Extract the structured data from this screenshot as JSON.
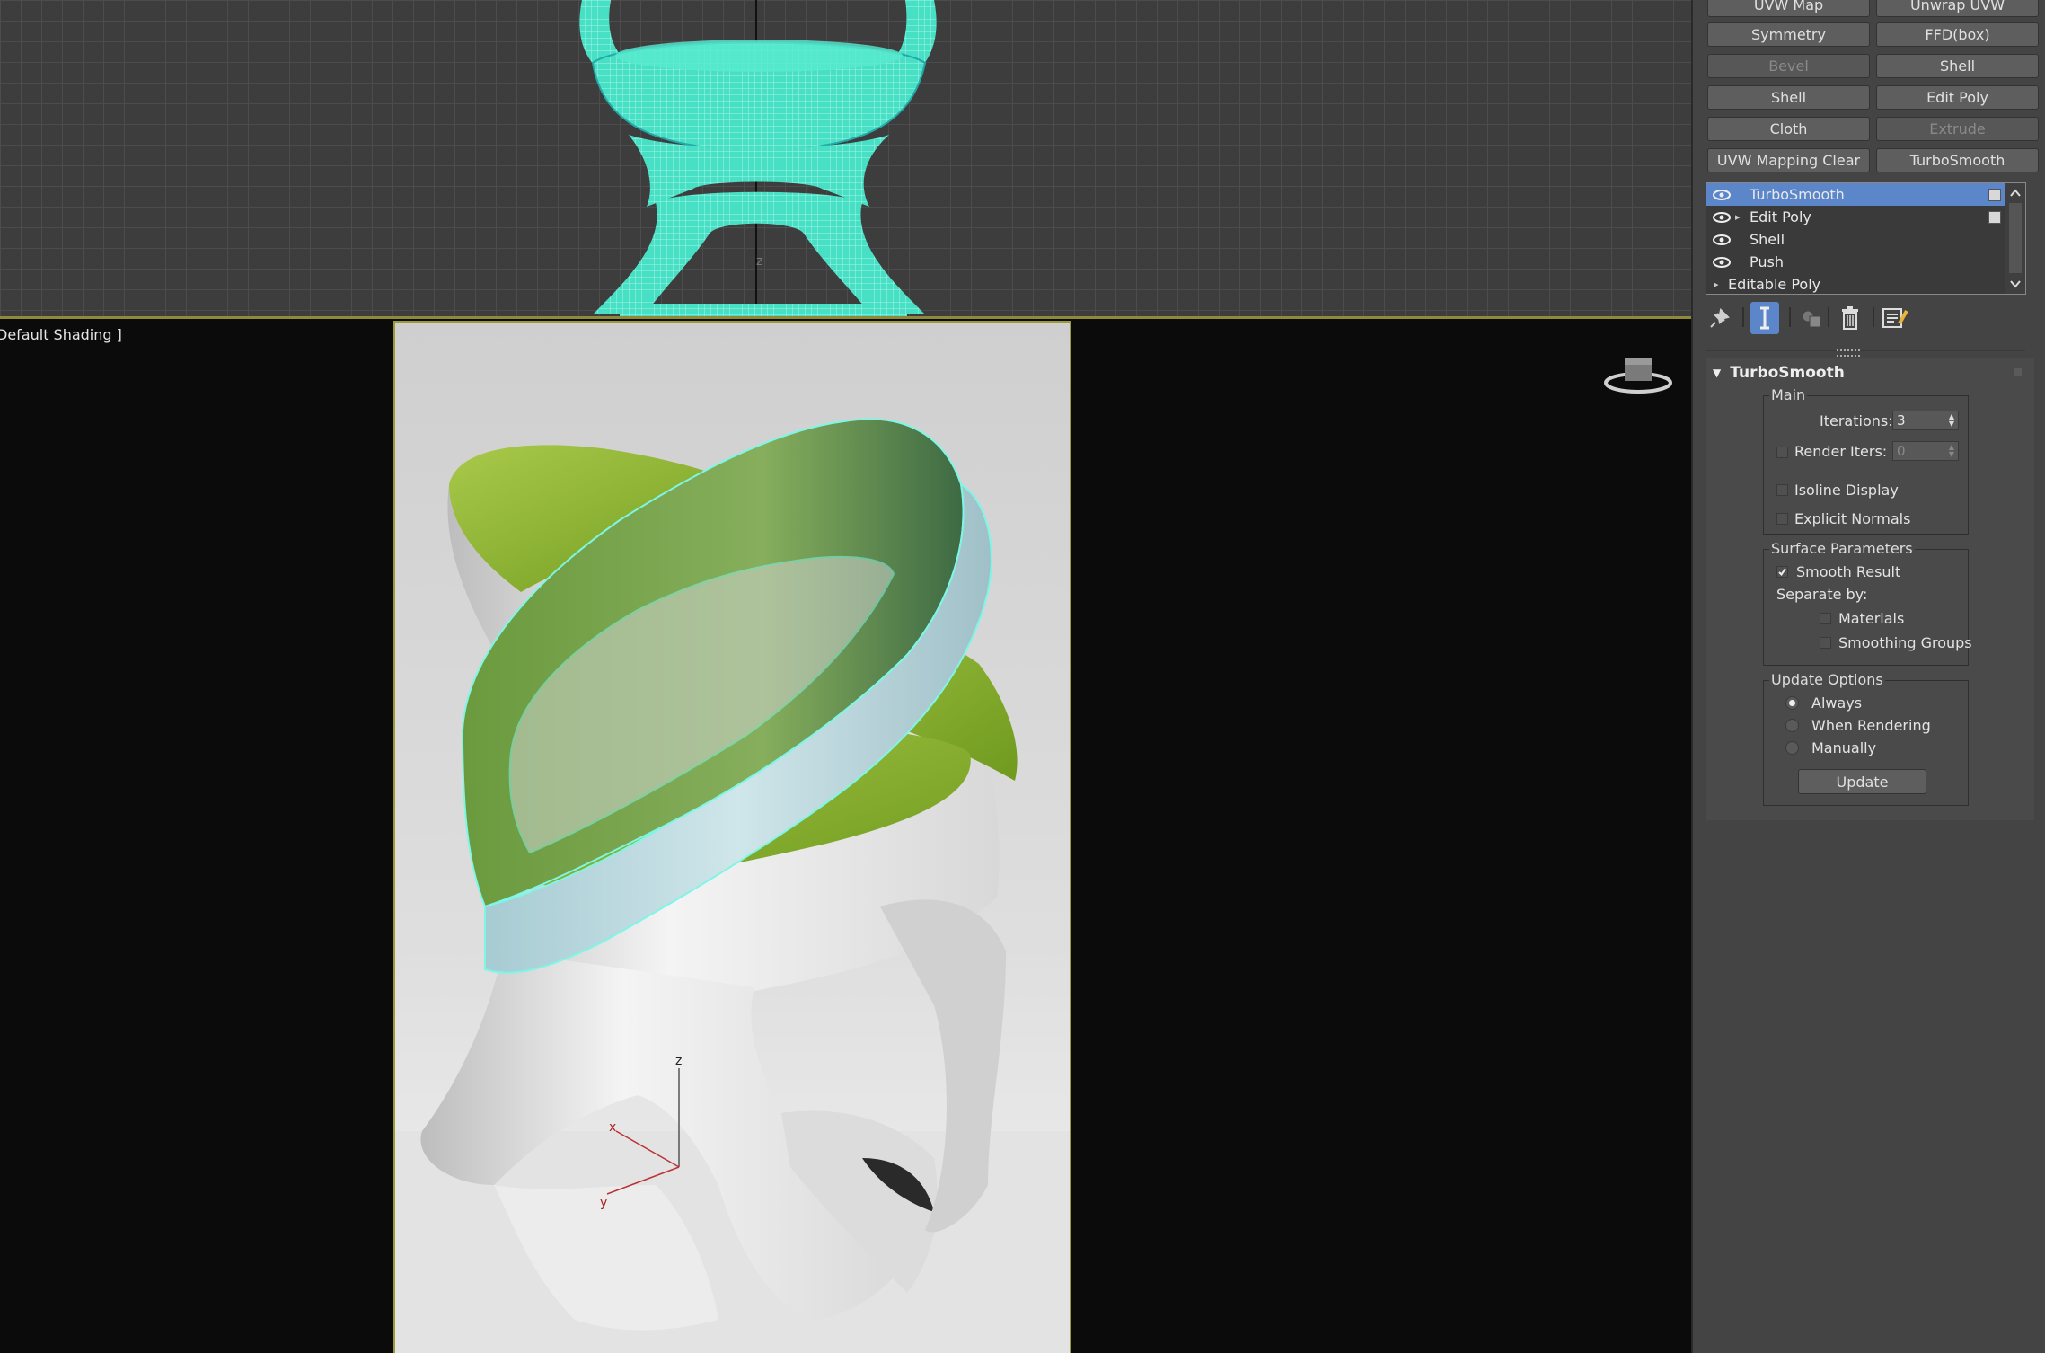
{
  "viewport": {
    "perspective_label": "Default Shading ]",
    "top_axis_label": "z",
    "gizmo_labels": {
      "z": "z",
      "x": "x",
      "y": "y"
    }
  },
  "modifier_buttons": [
    {
      "label": "UVW Map",
      "enabled": true
    },
    {
      "label": "Unwrap UVW",
      "enabled": true
    },
    {
      "label": "Symmetry",
      "enabled": true
    },
    {
      "label": "FFD(box)",
      "enabled": true
    },
    {
      "label": "Bevel",
      "enabled": false
    },
    {
      "label": "Shell",
      "enabled": true
    },
    {
      "label": "Shell",
      "enabled": true
    },
    {
      "label": "Edit Poly",
      "enabled": true
    },
    {
      "label": "Cloth",
      "enabled": true
    },
    {
      "label": "Extrude",
      "enabled": false
    },
    {
      "label": "UVW Mapping Clear",
      "enabled": true
    },
    {
      "label": "TurboSmooth",
      "enabled": true
    }
  ],
  "modifier_stack": [
    {
      "label": "TurboSmooth",
      "selected": true,
      "eye": true,
      "expander": false,
      "slot": true
    },
    {
      "label": "Edit Poly",
      "selected": false,
      "eye": true,
      "expander": true,
      "slot": true
    },
    {
      "label": "Shell",
      "selected": false,
      "eye": true,
      "expander": false,
      "slot": false
    },
    {
      "label": "Push",
      "selected": false,
      "eye": true,
      "expander": false,
      "slot": false
    },
    {
      "label": "Editable Poly",
      "selected": false,
      "eye": false,
      "expander": true,
      "slot": false
    }
  ],
  "toolbar_icons": [
    "pin-stack-icon",
    "show-end-result-icon",
    "make-unique-icon",
    "remove-modifier-icon",
    "configure-modifier-sets-icon"
  ],
  "rollout": {
    "title": "TurboSmooth",
    "main": {
      "group_label": "Main",
      "iterations_label": "Iterations:",
      "iterations_value": "3",
      "render_iters_label": "Render Iters:",
      "render_iters_value": "0",
      "isoline_label": "Isoline Display",
      "explicit_normals_label": "Explicit Normals"
    },
    "surface": {
      "group_label": "Surface Parameters",
      "smooth_result_label": "Smooth Result",
      "separate_by_label": "Separate by:",
      "materials_label": "Materials",
      "smoothing_groups_label": "Smoothing Groups"
    },
    "update": {
      "group_label": "Update Options",
      "always_label": "Always",
      "when_rendering_label": "When Rendering",
      "manually_label": "Manually",
      "update_button": "Update"
    }
  },
  "colors": {
    "selection_blue": "#5b86c9",
    "wireframe_cyan": "#3fe6c8",
    "seat_green": "#8bb52a"
  }
}
